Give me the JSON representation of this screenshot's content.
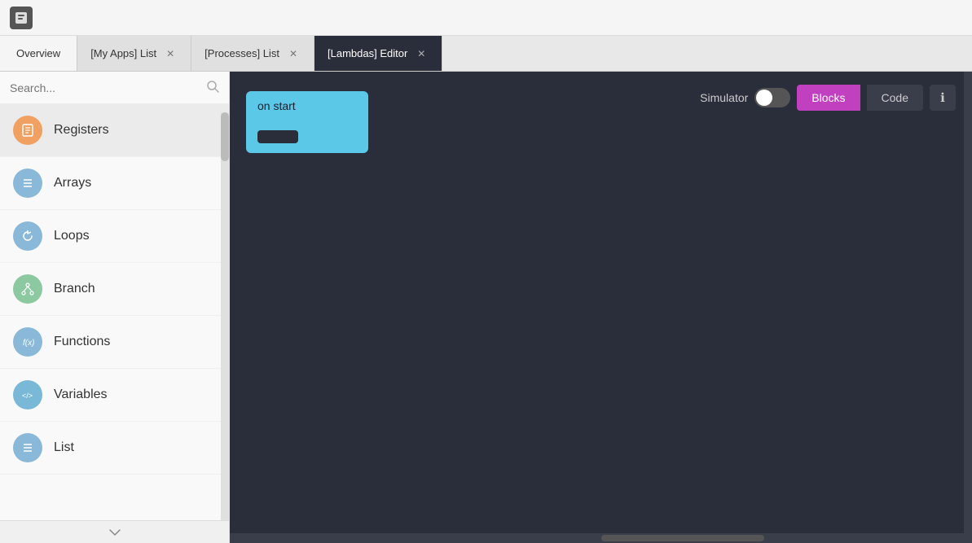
{
  "topbar": {
    "logo_icon": "📦"
  },
  "tabs": [
    {
      "label": "Overview",
      "closeable": false,
      "active": false
    },
    {
      "label": "[My Apps] List",
      "closeable": true,
      "active": false
    },
    {
      "label": "[Processes] List",
      "closeable": true,
      "active": false
    },
    {
      "label": "[Lambdas] Editor",
      "closeable": true,
      "active": true
    }
  ],
  "sidebar": {
    "search_placeholder": "Search...",
    "items": [
      {
        "id": "registers",
        "label": "Registers",
        "icon_class": "icon-registers",
        "icon": "📄"
      },
      {
        "id": "arrays",
        "label": "Arrays",
        "icon_class": "icon-arrays",
        "icon": "≡"
      },
      {
        "id": "loops",
        "label": "Loops",
        "icon_class": "icon-loops",
        "icon": "↺"
      },
      {
        "id": "branch",
        "label": "Branch",
        "icon_class": "icon-branch",
        "icon": "⑂"
      },
      {
        "id": "functions",
        "label": "Functions",
        "icon_class": "icon-functions",
        "icon": "f(x)"
      },
      {
        "id": "variables",
        "label": "Variables",
        "icon_class": "icon-variables",
        "icon": "</>"
      },
      {
        "id": "list",
        "label": "List",
        "icon_class": "icon-list",
        "icon": "≡"
      }
    ]
  },
  "editor": {
    "simulator_label": "Simulator",
    "blocks_button": "Blocks",
    "code_button": "Code",
    "info_button": "ℹ",
    "on_start_label": "on start"
  }
}
